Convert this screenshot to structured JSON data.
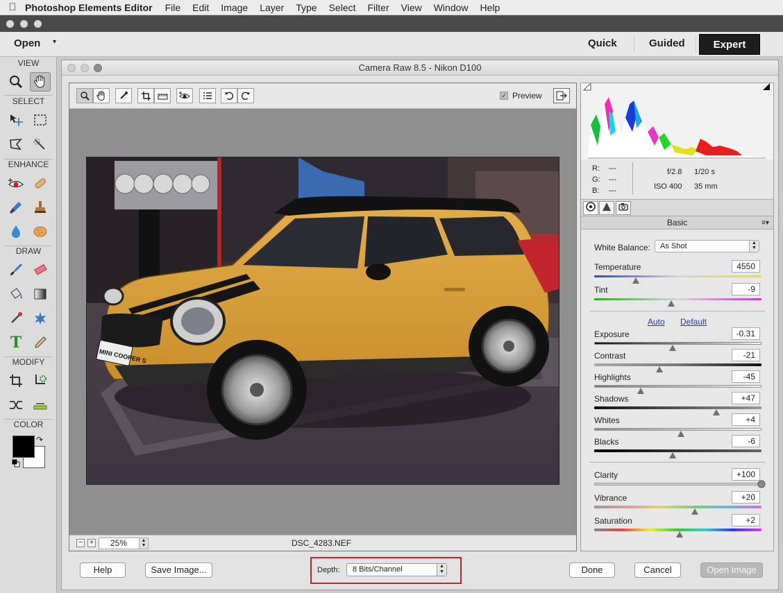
{
  "menubar": {
    "app_name": "Photoshop Elements Editor",
    "items": [
      "File",
      "Edit",
      "Image",
      "Layer",
      "Type",
      "Select",
      "Filter",
      "View",
      "Window",
      "Help"
    ]
  },
  "modebar": {
    "open_label": "Open",
    "modes": [
      "Quick",
      "Guided",
      "Expert"
    ],
    "active_mode": "Expert"
  },
  "toolbox": {
    "sections": [
      "VIEW",
      "SELECT",
      "ENHANCE",
      "DRAW",
      "MODIFY",
      "COLOR"
    ],
    "type_tool_glyph": "T"
  },
  "dialog": {
    "title": "Camera Raw 8.5  -  Nikon D100",
    "preview_label": "Preview",
    "preview_checked": true,
    "zoom": "25%",
    "filename": "DSC_4283.NEF",
    "readout": {
      "r_label": "R:",
      "g_label": "G:",
      "b_label": "B:",
      "r_val": "---",
      "g_val": "---",
      "b_val": "---",
      "aperture": "f/2.8",
      "shutter": "1/20 s",
      "iso": "ISO 400",
      "focal": "35 mm"
    },
    "panel_title": "Basic",
    "white_balance": {
      "label": "White Balance:",
      "value": "As Shot"
    },
    "auto_label": "Auto",
    "default_label": "Default",
    "sliders": [
      {
        "key": "temperature",
        "label": "Temperature",
        "value": "4550",
        "level": 0.25
      },
      {
        "key": "tint",
        "label": "Tint",
        "value": "-9",
        "level": 0.46
      },
      {
        "key": "exposure",
        "label": "Exposure",
        "value": "-0.31",
        "level": 0.47
      },
      {
        "key": "contrast",
        "label": "Contrast",
        "value": "-21",
        "level": 0.39
      },
      {
        "key": "highlights",
        "label": "Highlights",
        "value": "-45",
        "level": 0.28
      },
      {
        "key": "shadows",
        "label": "Shadows",
        "value": "+47",
        "level": 0.73
      },
      {
        "key": "whites",
        "label": "Whites",
        "value": "+4",
        "level": 0.52
      },
      {
        "key": "blacks",
        "label": "Blacks",
        "value": "-6",
        "level": 0.47
      },
      {
        "key": "clarity",
        "label": "Clarity",
        "value": "+100",
        "level": 1.0
      },
      {
        "key": "vibrance",
        "label": "Vibrance",
        "value": "+20",
        "level": 0.6
      },
      {
        "key": "saturation",
        "label": "Saturation",
        "value": "+2",
        "level": 0.51
      }
    ],
    "buttons": {
      "help": "Help",
      "save_image": "Save Image...",
      "done": "Done",
      "cancel": "Cancel",
      "open_image": "Open Image"
    },
    "depth": {
      "label": "Depth:",
      "value": "8 Bits/Channel"
    },
    "photo": {
      "plate_text": "MINI COOPER S"
    }
  },
  "colors": {
    "accent_highlight": "#d11f1f",
    "expert_bg": "#1d1d1d",
    "car_body": "#d9a23c"
  }
}
